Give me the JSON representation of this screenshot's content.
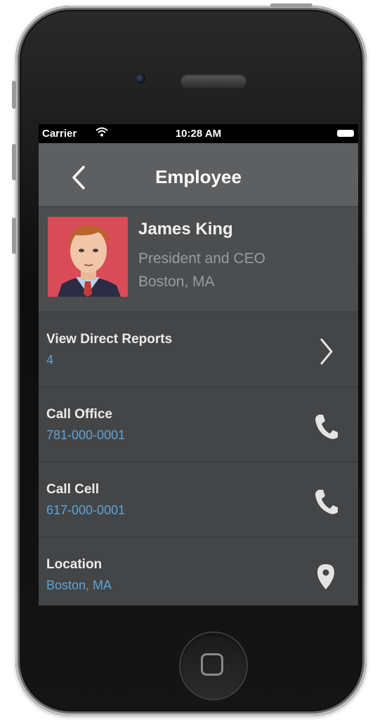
{
  "status_bar": {
    "carrier": "Carrier",
    "time": "10:28 AM"
  },
  "nav": {
    "title": "Employee",
    "back_icon": "chevron-left-icon"
  },
  "profile": {
    "name": "James King",
    "title": "President and CEO",
    "location": "Boston, MA"
  },
  "rows": [
    {
      "label": "View Direct Reports",
      "value": "4",
      "icon": "chevron-right-icon"
    },
    {
      "label": "Call Office",
      "value": "781-000-0001",
      "icon": "phone-icon"
    },
    {
      "label": "Call Cell",
      "value": "617-000-0001",
      "icon": "phone-icon"
    },
    {
      "label": "Location",
      "value": "Boston, MA",
      "icon": "map-pin-icon"
    }
  ],
  "colors": {
    "nav_background": "#5d5f61",
    "screen_background": "#434547",
    "link_blue": "#5fa3d6",
    "avatar_background": "#d94b56"
  }
}
